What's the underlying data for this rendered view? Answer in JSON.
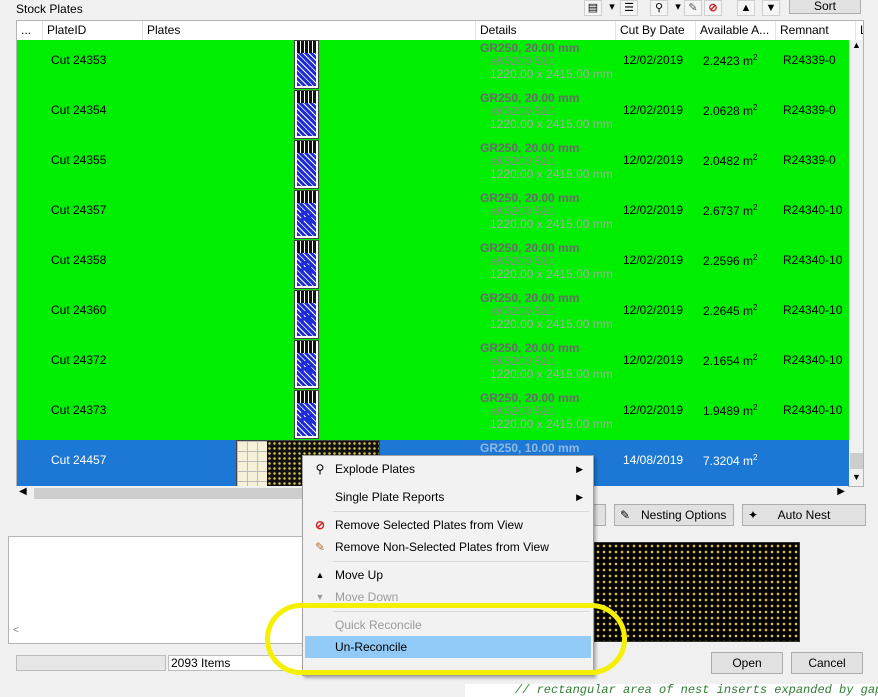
{
  "group_title": "Stock Plates",
  "toolbar": {
    "icons": [
      "report-icon",
      "layers-icon",
      "explode-icon",
      "remove-icon",
      "brush-icon"
    ],
    "sort_label": "Sort"
  },
  "columns": [
    "...",
    "PlateID",
    "Plates",
    "Details",
    "Cut By Date",
    "Available A...",
    "Remnant",
    "L"
  ],
  "rows": [
    {
      "id": "Cut 24353",
      "d1": "GR250, 20.00 mm",
      "d2": "aK5200 510",
      "d3": "1220.00 x 2415.00 mm",
      "date": "12/02/2019",
      "area": "2.2423 m",
      "unit": "2",
      "remnant": "R24339-0",
      "thumb": "dots",
      "selected": false
    },
    {
      "id": "Cut 24354",
      "d1": "GR250, 20.00 mm",
      "d2": "aK5200 510",
      "d3": "1220.00 x 2415.00 mm",
      "date": "12/02/2019",
      "area": "2.0628 m",
      "unit": "2",
      "remnant": "R24339-0",
      "thumb": "dots",
      "selected": false
    },
    {
      "id": "Cut 24355",
      "d1": "GR250, 20.00 mm",
      "d2": "aK5200 510",
      "d3": "1220.00 x 2415.00 mm",
      "date": "12/02/2019",
      "area": "2.0482 m",
      "unit": "2",
      "remnant": "R24339-0",
      "thumb": "dots",
      "selected": false
    },
    {
      "id": "Cut 24357",
      "d1": "GR250, 20.00 mm",
      "d2": "aK5200 510",
      "d3": "1220.00 x 2415.00 mm",
      "date": "12/02/2019",
      "area": "2.6737 m",
      "unit": "2",
      "remnant": "R24340-10",
      "thumb": "R",
      "selected": false
    },
    {
      "id": "Cut 24358",
      "d1": "GR250, 20.00 mm",
      "d2": "aK5200 510",
      "d3": "1220.00 x 2415.00 mm",
      "date": "12/02/2019",
      "area": "2.2596 m",
      "unit": "2",
      "remnant": "R24340-10",
      "thumb": "R",
      "selected": false
    },
    {
      "id": "Cut 24360",
      "d1": "GR250, 20.00 mm",
      "d2": "aK5200 510",
      "d3": "1220.00 x 2415.00 mm",
      "date": "12/02/2019",
      "area": "2.2645 m",
      "unit": "2",
      "remnant": "R24340-10",
      "thumb": "R",
      "selected": false
    },
    {
      "id": "Cut 24372",
      "d1": "GR250, 20.00 mm",
      "d2": "aK5200 510",
      "d3": "1220.00 x 2415.00 mm",
      "date": "12/02/2019",
      "area": "2.1654 m",
      "unit": "2",
      "remnant": "R24340-10",
      "thumb": "R",
      "selected": false
    },
    {
      "id": "Cut 24373",
      "d1": "GR250, 20.00 mm",
      "d2": "aK5200 510",
      "d3": "1220.00 x 2415.00 mm",
      "date": "12/02/2019",
      "area": "1.9489 m",
      "unit": "2",
      "remnant": "R24340-10",
      "thumb": "R",
      "selected": false
    },
    {
      "id": "Cut 24457",
      "d1": "GR250, 10.00 mm",
      "d2": "",
      "d3": "",
      "date": "14/08/2019",
      "area": "7.3204 m",
      "unit": "2",
      "remnant": "",
      "thumb": "wide",
      "selected": true
    }
  ],
  "buttons": {
    "nesting_options": "Nesting Options",
    "auto_nest": "Auto Nest",
    "open": "Open",
    "cancel": "Cancel"
  },
  "status": {
    "items_count": "2093 Items"
  },
  "context_menu": [
    {
      "label": "Explode Plates",
      "icon": "explode-icon",
      "submenu": true,
      "disabled": false,
      "highlighted": false
    },
    {
      "label": "Single Plate Reports",
      "icon": "",
      "submenu": true,
      "disabled": false,
      "highlighted": false
    },
    {
      "label": "Remove Selected Plates from View",
      "icon": "no-entry-icon",
      "submenu": false,
      "disabled": false,
      "highlighted": false
    },
    {
      "label": "Remove Non-Selected Plates from View",
      "icon": "brush-icon",
      "submenu": false,
      "disabled": false,
      "highlighted": false
    },
    {
      "label": "Move Up",
      "icon": "triangle-up-icon",
      "submenu": false,
      "disabled": false,
      "highlighted": false
    },
    {
      "label": "Move Down",
      "icon": "triangle-down-icon",
      "submenu": false,
      "disabled": true,
      "highlighted": false
    },
    {
      "label": "Quick Reconcile",
      "icon": "",
      "submenu": false,
      "disabled": true,
      "highlighted": false
    },
    {
      "label": "Un-Reconcile",
      "icon": "",
      "submenu": false,
      "disabled": false,
      "highlighted": true
    }
  ],
  "code_snippet": "// rectangular area of nest inserts expanded by gap",
  "colors": {
    "row_green": "#00ee00",
    "row_selected": "#1c78d4",
    "menu_highlight": "#91c9f7",
    "annotation_ring": "#f5f000"
  }
}
